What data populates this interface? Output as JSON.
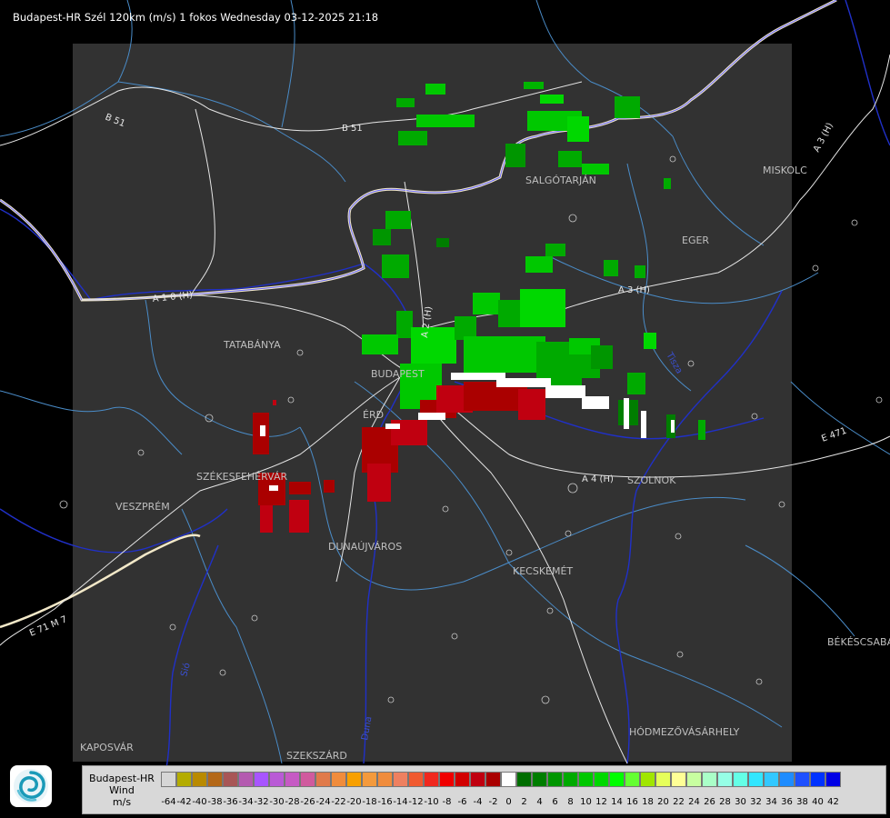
{
  "header": {
    "title": "Budapest-HR Szél 120km (m/s) 1 fokos Wednesday 03-12-2025 21:18"
  },
  "map": {
    "cities": [
      "SALGÓTARJÁN",
      "MISKOLC",
      "EGER",
      "TATABÁNYA",
      "BUDAPEST",
      "ÉRD",
      "SZÉKESFEHÉRVÁR",
      "VESZPRÉM",
      "DUNAÚJVÁROS",
      "KECSKEMÉT",
      "SZOLNOK",
      "BÉKÉSCSABA",
      "HÓDMEZŐVÁSÁRHELY",
      "KAPOSVÁR",
      "SZEKSZÁRD"
    ],
    "roads": [
      "B 51",
      "B 51",
      "A 3 (H)",
      "A 3 (H)",
      "A 1 0 (H)",
      "A 2 (H)",
      "A 4 (H)",
      "E 471",
      "E 71 M 7"
    ],
    "rivers": [
      "Tisza",
      "Sió",
      "Duna"
    ]
  },
  "legend": {
    "station": "Budapest-HR",
    "quantity": "Wind",
    "unit": "m/s",
    "ticks": [
      "-64",
      "-42",
      "-40",
      "-38",
      "-36",
      "-34",
      "-32",
      "-30",
      "-28",
      "-26",
      "-24",
      "-22",
      "-20",
      "-18",
      "-16",
      "-14",
      "-12",
      "-10",
      "-8",
      "-6",
      "-4",
      "-2",
      "0",
      "2",
      "4",
      "6",
      "8",
      "10",
      "12",
      "14",
      "16",
      "18",
      "20",
      "22",
      "24",
      "26",
      "28",
      "30",
      "32",
      "34",
      "36",
      "38",
      "40",
      "42"
    ],
    "colors": [
      "#d6d6d6",
      "#b4ac00",
      "#b98a00",
      "#b46818",
      "#a85656",
      "#b45ab0",
      "#a855ff",
      "#b95ad6",
      "#c65ac4",
      "#d05a9e",
      "#e07a4a",
      "#f08c3c",
      "#f8a000",
      "#f49a3c",
      "#f08c3c",
      "#ee8060",
      "#f05a30",
      "#f0281e",
      "#f00000",
      "#d20000",
      "#c00010",
      "#aa0000",
      "#ffffff",
      "#006e00",
      "#007e00",
      "#009600",
      "#00aa00",
      "#00c800",
      "#00d800",
      "#00ff00",
      "#64ff32",
      "#a0e600",
      "#e6ff5a",
      "#ffff96",
      "#c8ffa0",
      "#aaffc8",
      "#96ffe6",
      "#64ffe6",
      "#32e6ff",
      "#32c8ff",
      "#1e8cff",
      "#1e50ff",
      "#0032ff",
      "#0000e6"
    ]
  },
  "colors": {
    "background": "#000000",
    "radar_area": "#323232",
    "border": "#f2f2f2",
    "river": "#2030c8",
    "county": "#4a8cc8",
    "road": "#e6e6e6",
    "approach_wind": "#b4000c",
    "recede_wind": "#00b400"
  }
}
